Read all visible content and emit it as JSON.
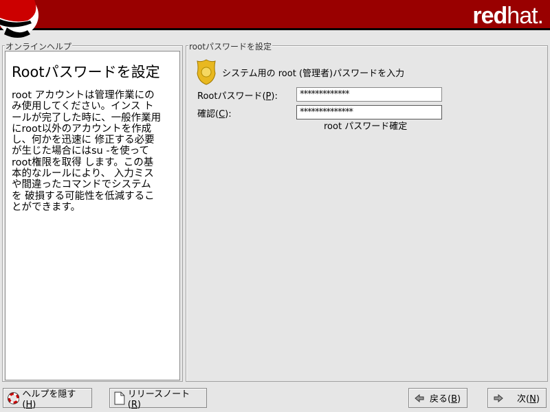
{
  "header": {
    "brand_bold": "red",
    "brand_light": "hat.",
    "colors": {
      "banner": "#990000"
    }
  },
  "help": {
    "frame_label": "オンラインヘルプ",
    "title": "Rootパスワードを設定",
    "lines": [
      "root アカウントは管理作業にの",
      "み使用してください。インス ト",
      "ールが完了した時に、一般作業用",
      "にroot以外のアカウントを作成",
      "し、何かを迅速に 修正する必要",
      "が生じた場合にはsu -を使って",
      "root権限を取得 します。この基",
      "本的なルールにより、 入力ミス",
      "や間違ったコマンドでシステム",
      "を 破損する可能性を低減するこ",
      "とができます。"
    ]
  },
  "main": {
    "frame_label": "rootパスワードを設定",
    "prompt": "システム用の root (管理者)パスワードを入力",
    "password_label": "Rootパスワード(",
    "password_key": "P",
    "password_label_end": "):",
    "password_value": "*************",
    "confirm_label": "確認(",
    "confirm_key": "C",
    "confirm_label_end": "):",
    "confirm_value": "**************",
    "status": "root パスワード確定"
  },
  "buttons": {
    "hide_help": {
      "label": "ヘルプを隠す(",
      "key": "H",
      "end": ")"
    },
    "release_notes": {
      "label": "リリースノート(",
      "key": "R",
      "end": ")"
    },
    "back": {
      "label": "戻る(",
      "key": "B",
      "end": ")"
    },
    "next": {
      "label": "次(",
      "key": "N",
      "end": ")"
    }
  }
}
